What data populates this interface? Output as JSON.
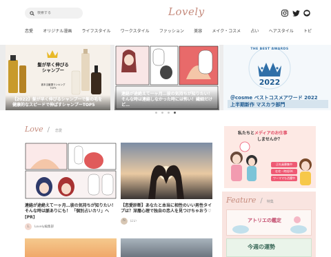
{
  "header": {
    "search_placeholder": "検索する",
    "logo": "Lovely",
    "social": [
      "instagram-icon",
      "twitter-icon",
      "line-icon"
    ]
  },
  "nav": [
    "恋愛",
    "オリジナル漫画",
    "ライフスタイル",
    "ワークスタイル",
    "ファッション",
    "美容",
    "メイク・コスメ",
    "占い",
    "ヘアスタイル",
    "トピ"
  ],
  "carousel": {
    "slides": [
      {
        "badge_line1": "髪が早く伸びる",
        "badge_line2": "シャンプー",
        "badge_sub": "被本当厳選ランキング",
        "badge_sub2": "TOP5",
        "caption": "【2022】髪が早く伸びるシャンプーで髪の毛を健康的なスピードで伸ばすシャンプーTOP5"
      },
      {
        "caption": "連絡が途絶えて一ヶ月…彼の気持ちが知りたい！そんな時は連絡しなかった時には怖い！繊細だけど…"
      },
      {
        "award": "THE BEST AWARDS",
        "year": "2022",
        "caption": "＠cosme ベストコスメアワード 2022 上半期新作 マスカラ部門"
      }
    ],
    "dots": 4,
    "active_dot": 3
  },
  "love_section": {
    "title_en": "Love",
    "title_jp": "恋愛",
    "cards": [
      {
        "title": "連絡が途絶えて一ヶ月…彼の気持ちが知りたい！そんな時は脈ありにも！ 「個別占いカリ」へ[PR]",
        "author": "Lovely編集部"
      },
      {
        "title": "【恋愛診断】あなたと本当に相性のいい男性タイプは？深層心理で独自の恋人を見つけちゃおう♡",
        "author": "にい"
      }
    ]
  },
  "sidebar": {
    "ad": {
      "line1": "私たちと",
      "highlight": "メディアのお仕事",
      "line2": "しませんか？",
      "tag1": "正社員募集中",
      "tag2": "在宅・時短OK",
      "tag3": "ワーママも活躍中"
    },
    "feature": {
      "title_en": "Feature",
      "title_jp": "特集",
      "card1": "アトリエの鑑定",
      "card2": "今週の運勢"
    }
  },
  "colors": {
    "accent": "#c58b7d",
    "pink": "#ef5a74",
    "hero_pink": "#e14a63"
  }
}
